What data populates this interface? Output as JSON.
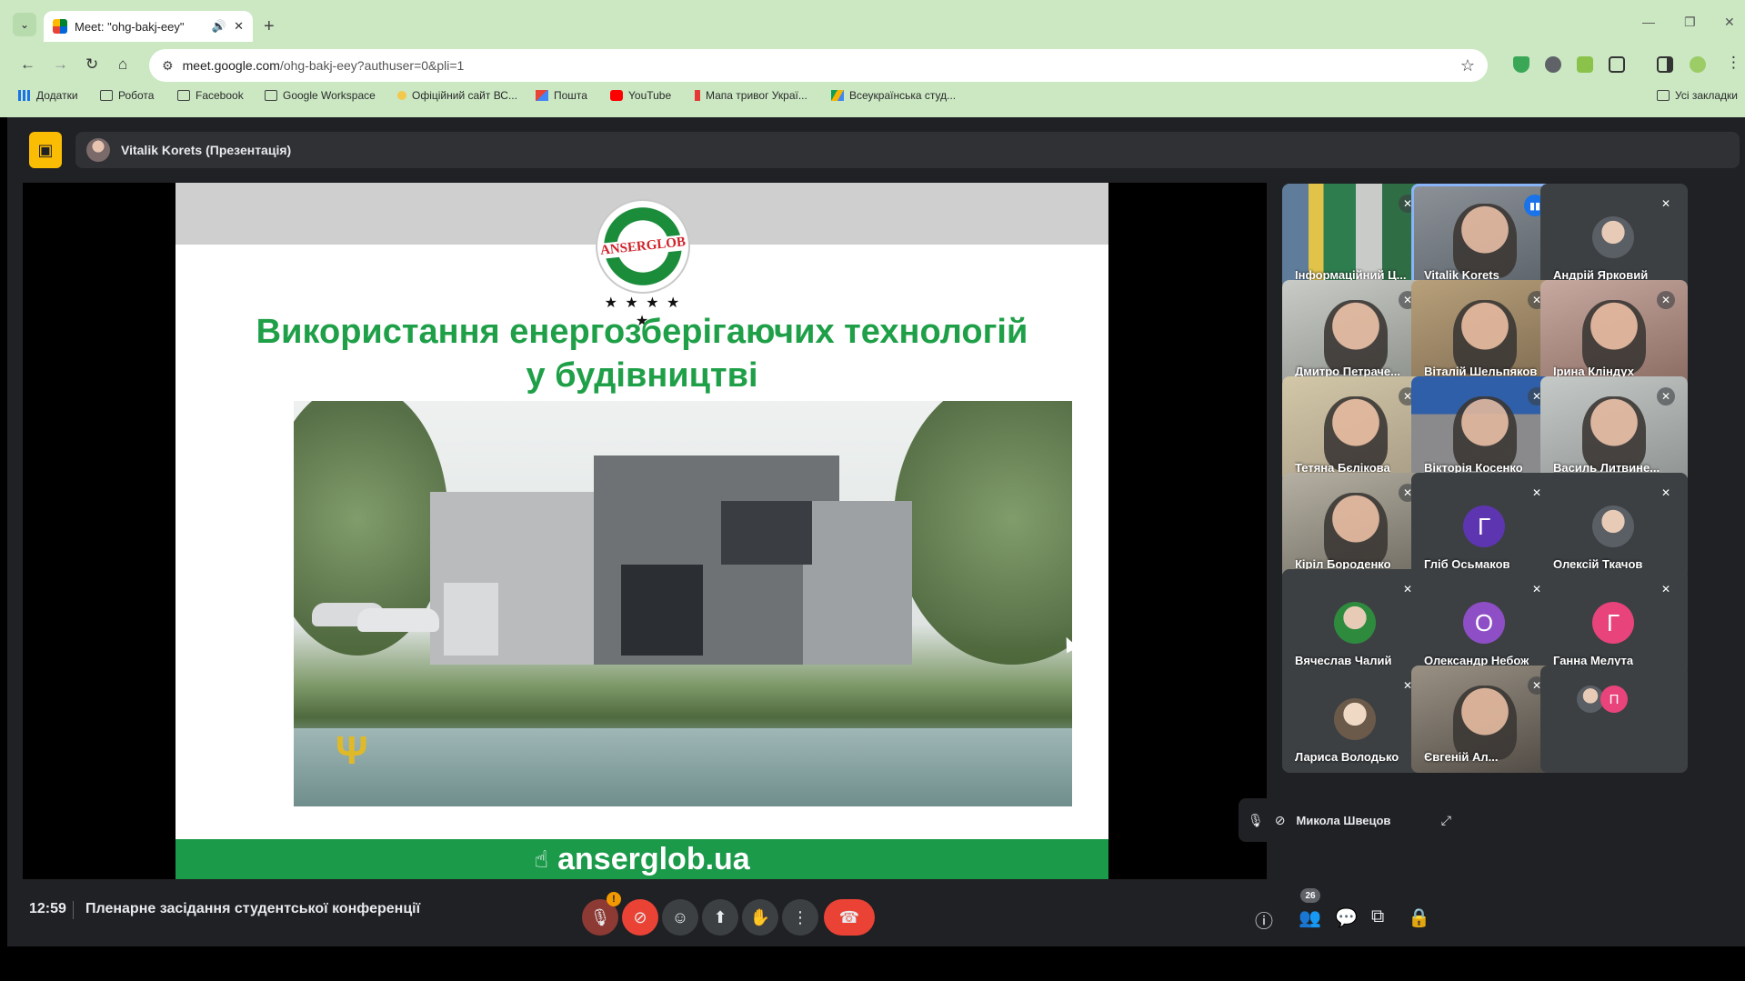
{
  "browser": {
    "tab": {
      "title": "Meet: \"ohg-bakj-eey\""
    },
    "address": {
      "host": "meet.google.com",
      "path": "/ohg-bakj-eey?authuser=0&pli=1"
    },
    "bookmarks": [
      {
        "label": "Додатки",
        "icon": "apps-grid-icon"
      },
      {
        "label": "Робота",
        "icon": "folder-icon"
      },
      {
        "label": "Facebook",
        "icon": "folder-icon"
      },
      {
        "label": "Google Workspace",
        "icon": "folder-icon"
      },
      {
        "label": "Офіційний сайт ВС...",
        "icon": "site-icon"
      },
      {
        "label": "Пошта",
        "icon": "gmail-icon"
      },
      {
        "label": "YouTube",
        "icon": "youtube-icon"
      },
      {
        "label": "Мапа тривог Украї...",
        "icon": "map-icon"
      },
      {
        "label": "Всеукраїнська студ...",
        "icon": "drive-icon"
      }
    ],
    "all_bookmarks": "Усі закладки"
  },
  "meet": {
    "presenter": {
      "name": "Vitalik Korets (Презентація)"
    },
    "slide": {
      "logo_text": "ANSERGLOB",
      "stars": "★ ★ ★ ★ ★",
      "title_line1": "Використання енергозберігаючих технологій",
      "title_line2": "у будівництві",
      "footer_site": "anserglob.ua"
    },
    "participants": [
      {
        "name": "Інформаційний Ц...",
        "kind": "video",
        "muted": true
      },
      {
        "name": "Vitalik Korets",
        "kind": "video",
        "speaking": true
      },
      {
        "name": "Андрій Ярковий",
        "kind": "avatar",
        "muted": true
      },
      {
        "name": "Дмитро Петраче...",
        "kind": "video",
        "muted": true
      },
      {
        "name": "Віталій Шельпяков",
        "kind": "video",
        "muted": true
      },
      {
        "name": "Ірина Кліндух",
        "kind": "video",
        "muted": true
      },
      {
        "name": "Тетяна Бєлікова",
        "kind": "video",
        "muted": true
      },
      {
        "name": "Вікторія Косенко",
        "kind": "video",
        "muted": true
      },
      {
        "name": "Василь Литвине...",
        "kind": "video",
        "muted": true
      },
      {
        "name": "Кіріл Бороденко",
        "kind": "video",
        "muted": true
      },
      {
        "name": "Гліб Осьмаков",
        "kind": "letter",
        "letter": "Г",
        "color": "#5e35b1",
        "muted": true
      },
      {
        "name": "Олексій Ткачов",
        "kind": "avatar",
        "muted": true
      },
      {
        "name": "Вячеслав Чалий",
        "kind": "avatar",
        "muted": true
      },
      {
        "name": "Олександр Небож",
        "kind": "letter",
        "letter": "О",
        "color": "#8e4ec6",
        "muted": true
      },
      {
        "name": "Ганна Мелута",
        "kind": "letter",
        "letter": "Г",
        "color": "#e8437a",
        "muted": true
      },
      {
        "name": "Лариса Володько",
        "kind": "avatar",
        "muted": true
      },
      {
        "name": "Євгеній Ал...",
        "kind": "video",
        "muted": true
      }
    ],
    "pip": {
      "name": "Микола Швецов",
      "letter": "П"
    },
    "bottom": {
      "time": "12:59",
      "meeting_title": "Пленарне засідання студентської конференції",
      "warning": "!",
      "people_count": "26"
    }
  },
  "colors": {
    "chrome_green": "#cbe8c3",
    "meet_bg": "#202124",
    "hangup": "#ea4335",
    "slide_green": "#1fa048",
    "speaking_ring": "#8ab4f8"
  }
}
